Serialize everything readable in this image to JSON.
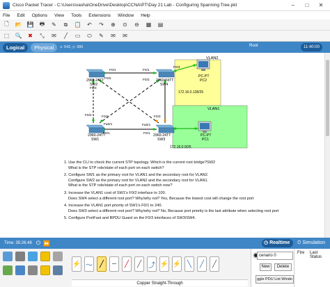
{
  "window": {
    "title": "Cisco Packet Tracer - C:\\Users\\vasha\\OneDrive\\Desktop\\CCNA\\PT\\Day 21 Lab - Configuring Spanning Tree.pkt"
  },
  "menu": [
    "File",
    "Edit",
    "Options",
    "View",
    "Tools",
    "Extensions",
    "Window",
    "Help"
  ],
  "viewbar": {
    "logical": "Logical",
    "physical": "Physical",
    "coords": "x: 542, y: 389",
    "root": "Root",
    "clock": "11:40:00"
  },
  "colors": {
    "vlan2": "#ffff99",
    "vlan1": "#99ff99",
    "link_green": "#00aa00",
    "accent": "#3f86c6"
  },
  "topology": {
    "vlan2_label": "VLAN2",
    "vlan1_label": "VLAN1",
    "sw1": {
      "model": "2960-24TT",
      "name": "SW1"
    },
    "sw2": {
      "model": "2960-24TT",
      "name": "SW2"
    },
    "sw3": {
      "model": "2960-24TT",
      "name": "SW3"
    },
    "sw4": {
      "model": "2960-24TT",
      "name": "SW4"
    },
    "pc1": {
      "model": "PC-PT",
      "name": "PC1"
    },
    "pc2": {
      "model": "PC-PT",
      "name": "PC2"
    },
    "subnet_vlan2": "172.16.0.128/25",
    "subnet_vlan1": "172.16.0.0/25",
    "ports": {
      "sw2_f01": "F0/1",
      "sw2_f03": "F0/3",
      "sw2_f02": "F0/2",
      "sw4_f01": "F0/1",
      "sw4_f02": "F0/2",
      "sw4_f03": "F0/3",
      "sw1_f02": "F0/2",
      "sw1_f01": "F0/1",
      "sw1_fa01": "Fa0/1",
      "sw3_f03": "F0/3",
      "sw3_f02": "F0/2",
      "sw3_f01": "F0/1",
      "sw3_fa01": "Fa0/1"
    }
  },
  "instructions": [
    [
      "1. Use the CLI to check the current STP topology.  Which is the current root bridge?SW2",
      "What is the STP role/state of each port on each switch?"
    ],
    [
      "2. Configure SW1 as the primary root for VLAN1 and the secondary root for VLAN2.",
      "Configure SW2 as the primary root for VLAN2 and the secondary root for VLAN1.",
      "What is the STP role/state of each port on each switch now?"
    ],
    [
      "3. Increase the VLAN1 cost of SW1's F0/2 interface to 100.",
      "Does SW4 select a different root port?  Why/why not? Yes, Because the lowest cost will change the root port"
    ],
    [
      "4. Increase the VLAN1 port priority of SW1's F0/1 to 240.",
      "Does SW3 select a different root port?  Why/why not? No, Because port priority is the last attribute when selecting root port"
    ],
    [
      "5. Configure PortFast and BPDU Guard on the F0/3 interfaces of SW3/SW4."
    ]
  ],
  "timebar": {
    "time": "Time: 35:26:48",
    "realtime": "Realtime",
    "simulation": "Simulation"
  },
  "connections": {
    "selected_name": "Copper Straight-Through"
  },
  "pdu": {
    "scenario": "cenario 0",
    "new": "New",
    "delete": "Delete",
    "toggle": "ggle PDU List Windo"
  },
  "events": {
    "fire": "Fire",
    "last_status": "Last Status"
  }
}
